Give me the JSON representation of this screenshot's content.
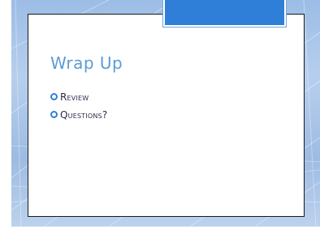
{
  "slide": {
    "title": "Wrap Up",
    "bullets": [
      {
        "label": "Review",
        "marker_icon": "ring-bullet-icon"
      },
      {
        "label": "Questions?",
        "marker_icon": "ring-bullet-icon"
      }
    ]
  },
  "colors": {
    "accent": "#2f7fd9",
    "title": "#5b9bd5",
    "body_text": "#2b2b4a",
    "background": "#a8c4ea"
  }
}
